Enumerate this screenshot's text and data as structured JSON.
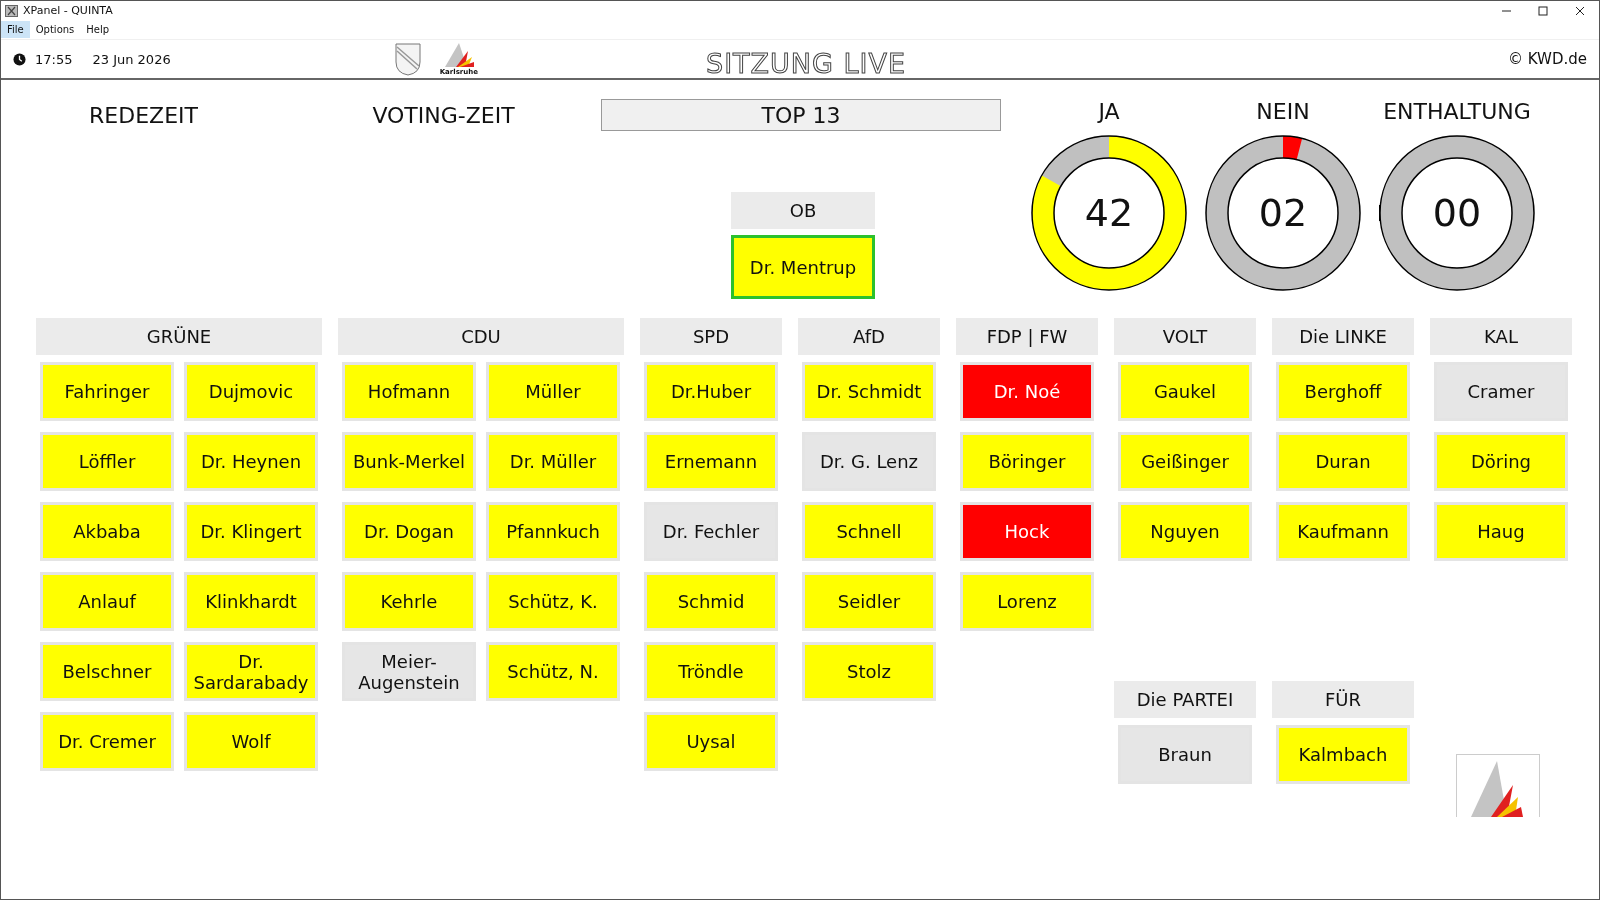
{
  "window": {
    "title": "XPanel - QUINTA"
  },
  "menu": [
    {
      "label": "File",
      "selected": true
    },
    {
      "label": "Options",
      "selected": false
    },
    {
      "label": "Help",
      "selected": false
    }
  ],
  "header": {
    "time": "17:55",
    "date": "23 Jun 2026",
    "logo_caption": "Karlsruhe",
    "title": "SITZUNG LIVE",
    "copyright": "© KWD.de"
  },
  "timers": [
    "REDEZEIT",
    "VOTING-ZEIT"
  ],
  "agenda_item": "TOP 13",
  "ob": {
    "label": "OB",
    "seat": {
      "name": "Dr. Mentrup",
      "color": "#ffff00",
      "highlighted": true
    }
  },
  "tallies": [
    {
      "label": "JA",
      "count": "42",
      "level": 0.83,
      "color": "#ffff00"
    },
    {
      "label": "NEIN",
      "count": "02",
      "level": 0.04,
      "color": "#ff0000"
    },
    {
      "label": "ENTHALTUNG",
      "count": "00",
      "level": 0
    }
  ],
  "columns": [
    {
      "parties": [
        {
          "name": "GRÜNE",
          "seats": [
            {
              "name": "Fahringer",
              "color": "#ffff00"
            },
            {
              "name": "Dujmovic",
              "color": "#ffff00"
            },
            {
              "name": "Löffler",
              "color": "#ffff00"
            },
            {
              "name": "Dr. Heynen",
              "color": "#ffff00"
            },
            {
              "name": "Akbaba",
              "color": "#ffff00"
            },
            {
              "name": "Dr. Klingert",
              "color": "#ffff00"
            },
            {
              "name": "Anlauf",
              "color": "#ffff00"
            },
            {
              "name": "Klinkhardt",
              "color": "#ffff00"
            },
            {
              "name": "Belschner",
              "color": "#ffff00"
            },
            {
              "name": "Dr. Sardarabady",
              "color": "#ffff00"
            },
            {
              "name": "Dr. Cremer",
              "color": "#ffff00"
            },
            {
              "name": "Wolf",
              "color": "#ffff00"
            }
          ]
        }
      ]
    },
    {
      "parties": [
        {
          "name": "CDU",
          "seats": [
            {
              "name": "Hofmann",
              "color": "#ffff00"
            },
            {
              "name": "Müller",
              "color": "#ffff00"
            },
            {
              "name": "Bunk-Merkel",
              "color": "#ffff00"
            },
            {
              "name": "Dr. Müller",
              "color": "#ffff00"
            },
            {
              "name": "Dr. Dogan",
              "color": "#ffff00"
            },
            {
              "name": "Pfannkuch",
              "color": "#ffff00"
            },
            {
              "name": "Kehrle",
              "color": "#ffff00"
            },
            {
              "name": "Schütz, K.",
              "color": "#ffff00"
            },
            {
              "name": "Meier-Augenstein",
              "color": "#e6e6e6"
            },
            {
              "name": "Schütz, N.",
              "color": "#ffff00"
            }
          ]
        }
      ]
    },
    {
      "parties": [
        {
          "name": "SPD",
          "seats": [
            {
              "name": "Dr.Huber",
              "color": "#ffff00"
            },
            {
              "name": "Ernemann",
              "color": "#ffff00"
            },
            {
              "name": "Dr. Fechler",
              "color": "#e6e6e6"
            },
            {
              "name": "Schmid",
              "color": "#ffff00"
            },
            {
              "name": "Tröndle",
              "color": "#ffff00"
            },
            {
              "name": "Uysal",
              "color": "#ffff00"
            }
          ]
        }
      ]
    },
    {
      "parties": [
        {
          "name": "AfD",
          "seats": [
            {
              "name": "Dr. Schmidt",
              "color": "#ffff00"
            },
            {
              "name": "Dr. G. Lenz",
              "color": "#e6e6e6"
            },
            {
              "name": "Schnell",
              "color": "#ffff00"
            },
            {
              "name": "Seidler",
              "color": "#ffff00"
            },
            {
              "name": "Stolz",
              "color": "#ffff00"
            }
          ]
        }
      ]
    },
    {
      "parties": [
        {
          "name": "FDP | FW",
          "seats": [
            {
              "name": "Dr. Noé",
              "color": "#ff0000"
            },
            {
              "name": "Böringer",
              "color": "#ffff00"
            },
            {
              "name": "Hock",
              "color": "#ff0000"
            },
            {
              "name": "Lorenz",
              "color": "#ffff00"
            }
          ]
        }
      ]
    },
    {
      "parties": [
        {
          "name": "VOLT",
          "seats": [
            {
              "name": "Gaukel",
              "color": "#ffff00"
            },
            {
              "name": "Geißinger",
              "color": "#ffff00"
            },
            {
              "name": "Nguyen",
              "color": "#ffff00"
            }
          ]
        },
        {
          "name": "Die PARTEI",
          "seats": [
            {
              "name": "Braun",
              "color": "#e6e6e6"
            }
          ]
        }
      ]
    },
    {
      "parties": [
        {
          "name": "Die LINKE",
          "seats": [
            {
              "name": "Berghoff",
              "color": "#ffff00"
            },
            {
              "name": "Duran",
              "color": "#ffff00"
            },
            {
              "name": "Kaufmann",
              "color": "#ffff00"
            }
          ]
        },
        {
          "name": "FÜR",
          "seats": [
            {
              "name": "Kalmbach",
              "color": "#ffff00"
            }
          ]
        }
      ]
    },
    {
      "parties": [
        {
          "name": "KAL",
          "seats": [
            {
              "name": "Cramer",
              "color": "#e6e6e6"
            },
            {
              "name": "Döring",
              "color": "#ffff00"
            },
            {
              "name": "Haug",
              "color": "#ffff00"
            }
          ]
        }
      ]
    }
  ]
}
